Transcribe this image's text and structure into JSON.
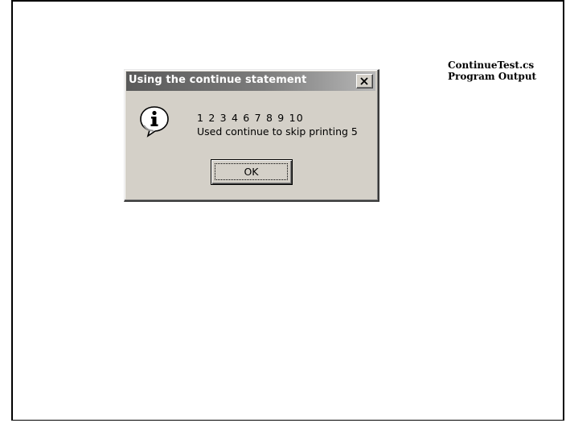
{
  "slide": {
    "caption_line1": "ContinueTest.cs",
    "caption_line2": "Program Output"
  },
  "dialog": {
    "title": "Using the continue statement",
    "icon": "information-icon",
    "message_line1": "1 2 3 4 6 7 8 9 10",
    "message_line2": "Used continue to skip printing 5",
    "ok_label": "OK",
    "close_icon": "close-icon"
  },
  "colors": {
    "dialog_face": "#d4d0c8",
    "titlebar_dark": "#5a5a5a",
    "titlebar_light": "#b7b7b7"
  }
}
